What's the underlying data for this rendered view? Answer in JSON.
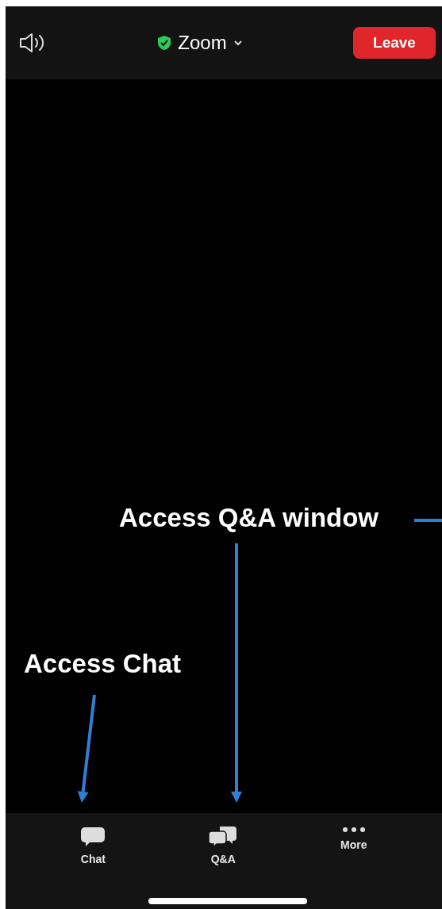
{
  "header": {
    "title": "Zoom",
    "leave_button": "Leave"
  },
  "annotations": [
    {
      "text": "Access Q&A window"
    },
    {
      "text": "Access Chat"
    }
  ],
  "toolbar": [
    {
      "label": "Chat",
      "kind": "chat"
    },
    {
      "label": "Q&A",
      "kind": "qa"
    },
    {
      "label": "More",
      "kind": "more"
    }
  ]
}
